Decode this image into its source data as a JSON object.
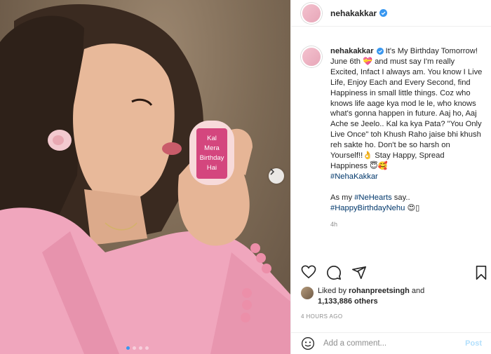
{
  "photo": {
    "case_label_lines": [
      "Kal",
      "Mera",
      "Birthday",
      "Hai"
    ],
    "carousel_index": 1,
    "carousel_count": 4
  },
  "header": {
    "username": "nehakakkar"
  },
  "caption": {
    "username": "nehakakkar",
    "text_1": " It's My Birthday Tomorrow! June 6th ",
    "emoji_1": "💝",
    "text_2": " and must say I'm really Excited, Infact I always am. You know I Live Life, Enjoy Each and Every Second, find Happiness in small little things. Coz who knows life aage kya mod le le, who knows what's gonna happen in future. Aaj ho, Aaj Ache se Jeelo.. Kal ka kya Pata? \"You Only Live Once\" toh Khush Raho jaise bhi khush reh sakte ho. Don't be so harsh on Yourself!!",
    "emoji_2": "👌",
    "text_3": " Stay Happy, Spread Happiness ",
    "emoji_3": "😇🥰",
    "hashtag_1": "#NehaKakkar",
    "text_4": "As my ",
    "hashtag_2": "#NeHearts",
    "text_5": " say..",
    "hashtag_3": "#HappyBirthdayNehu",
    "emoji_4": "😍▯",
    "time": "4h"
  },
  "likes": {
    "prefix": "Liked by ",
    "user": "rohanpreetsingh",
    "middle": " and",
    "count": "1,133,886 others"
  },
  "timestamp": "4 HOURS AGO",
  "comment": {
    "placeholder": "Add a comment...",
    "post_label": "Post"
  },
  "colors": {
    "accent": "#3897f0",
    "hashtag": "#00376b",
    "label_pink": "#d4467e",
    "post_disabled": "#b2dffc"
  }
}
